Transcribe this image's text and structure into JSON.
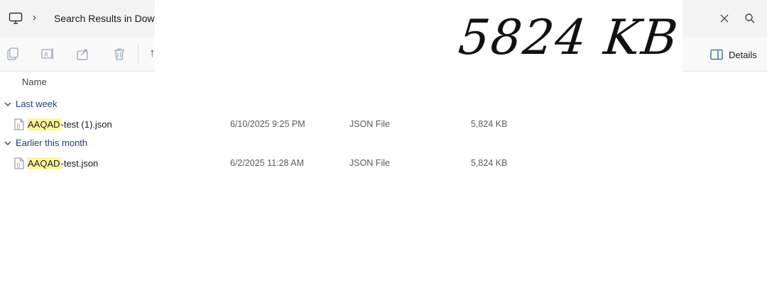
{
  "address": {
    "breadcrumb": "Search Results in Dow",
    "pc_icon": "computer-icon",
    "chevron": "›"
  },
  "toolbar": {
    "copy_icon": "copy-icon",
    "rename_icon": "rename-icon",
    "share_icon": "share-icon",
    "delete_icon": "delete-icon",
    "sort_partial": "↑",
    "details_label": "Details"
  },
  "overlay": {
    "handwritten_text": "5824 KB"
  },
  "list": {
    "name_header": "Name",
    "groups": [
      {
        "label": "Last week",
        "files": [
          {
            "match": "AAQAD",
            "rest": "-test (1).json",
            "date": "6/10/2025 9:25 PM",
            "type": "JSON File",
            "size": "5,824 KB"
          }
        ]
      },
      {
        "label": "Earlier this month",
        "files": [
          {
            "match": "AAQAD",
            "rest": "-test.json",
            "date": "6/2/2025 11:28 AM",
            "type": "JSON File",
            "size": "5,824 KB"
          }
        ]
      }
    ]
  },
  "colors": {
    "highlight": "#fff59d",
    "group_text": "#1f3f7a",
    "disabled_icon": "#9aa7b8"
  }
}
